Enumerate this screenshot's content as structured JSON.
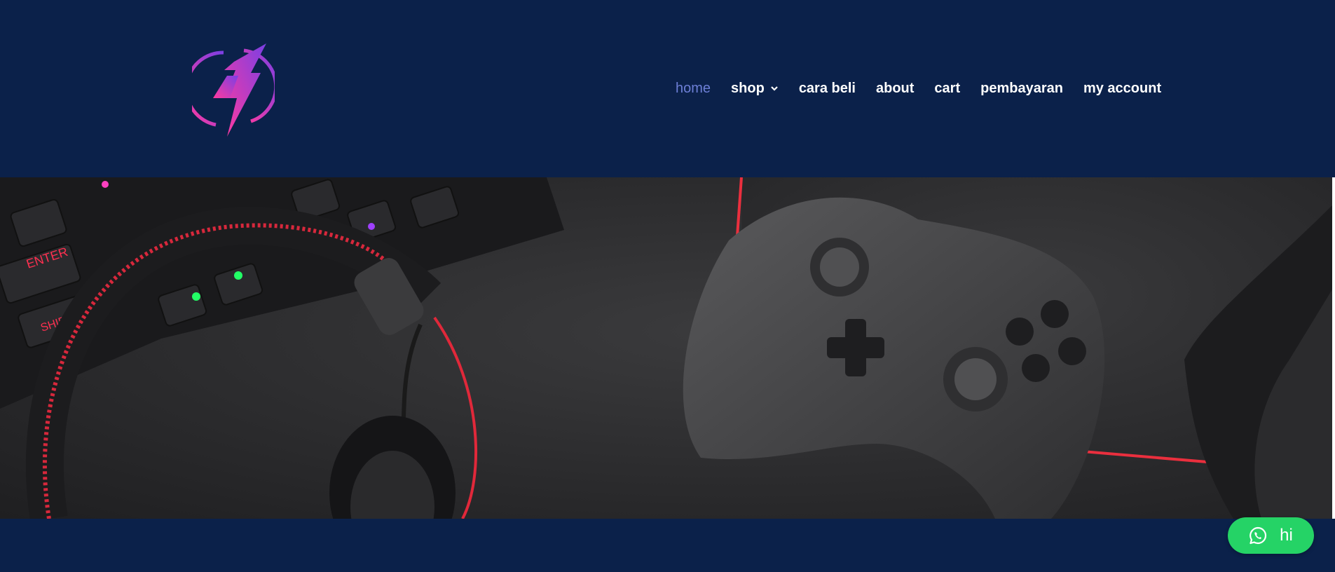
{
  "nav": {
    "items": [
      {
        "label": "home",
        "active": true
      },
      {
        "label": "shop",
        "has_dropdown": true
      },
      {
        "label": "cara beli"
      },
      {
        "label": "about"
      },
      {
        "label": "cart"
      },
      {
        "label": "pembayaran"
      },
      {
        "label": "my account"
      }
    ]
  },
  "chat_button": {
    "label": "hi",
    "icon": "whatsapp-icon"
  },
  "colors": {
    "header_bg": "#0b214a",
    "nav_text": "#ffffff",
    "nav_active": "#6d7fd6",
    "chat_green": "#25d366",
    "logo_pink": "#e23ba6",
    "logo_purple": "#7b3fe4"
  },
  "logo": {
    "icon": "lightning-bolt-logo"
  },
  "hero": {
    "image": "gaming-setup-photo",
    "content": [
      "keyboard",
      "headset",
      "game-controller"
    ]
  }
}
